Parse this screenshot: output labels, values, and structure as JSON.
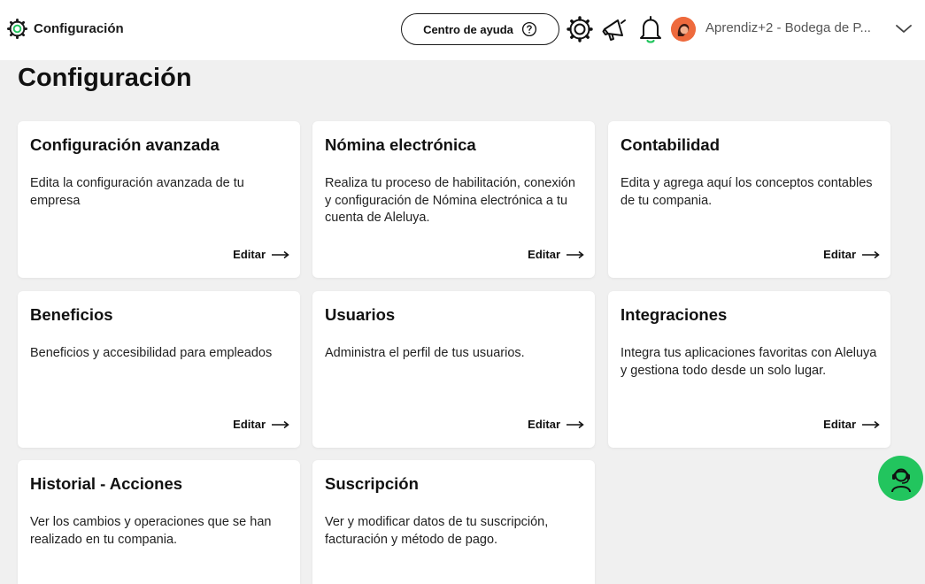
{
  "header": {
    "title": "Configuración",
    "help_button": "Centro de ayuda",
    "account_name": "Aprendiz+2 - Bodega de P..."
  },
  "page": {
    "title": "Configuración"
  },
  "cards": [
    {
      "title": "Configuración avanzada",
      "description": "Edita la configuración avanzada de tu empresa",
      "action": "Editar"
    },
    {
      "title": "Nómina electrónica",
      "description": "Realiza tu proceso de habilitación, conexión y configuración de Nómina electrónica a tu cuenta de Aleluya.",
      "action": "Editar"
    },
    {
      "title": "Contabilidad",
      "description": "Edita y agrega aquí los conceptos contables de tu compania.",
      "action": "Editar"
    },
    {
      "title": "Beneficios",
      "description": "Beneficios y accesibilidad para empleados",
      "action": "Editar"
    },
    {
      "title": "Usuarios",
      "description": "Administra el perfil de tus usuarios.",
      "action": "Editar"
    },
    {
      "title": "Integraciones",
      "description": "Integra tus aplicaciones favoritas con Aleluya y gestiona todo desde un solo lugar.",
      "action": "Editar"
    },
    {
      "title": "Historial - Acciones",
      "description": "Ver los cambios y operaciones que se han realizado en tu compania."
    },
    {
      "title": "Suscripción",
      "description": "Ver y modificar datos de tu suscripción, facturación y método de pago."
    }
  ],
  "colors": {
    "accent": "#22c55e",
    "avatar": "#ee6a3d",
    "background": "#f0f0f0"
  },
  "icons": {
    "brand": "gear-icon",
    "help": "question-circle-icon",
    "settings": "gear-icon",
    "announcements": "megaphone-icon",
    "notifications": "bell-icon",
    "account_menu": "chevron-down-icon",
    "support": "support-agent-icon",
    "edit": "arrow-right-icon"
  }
}
